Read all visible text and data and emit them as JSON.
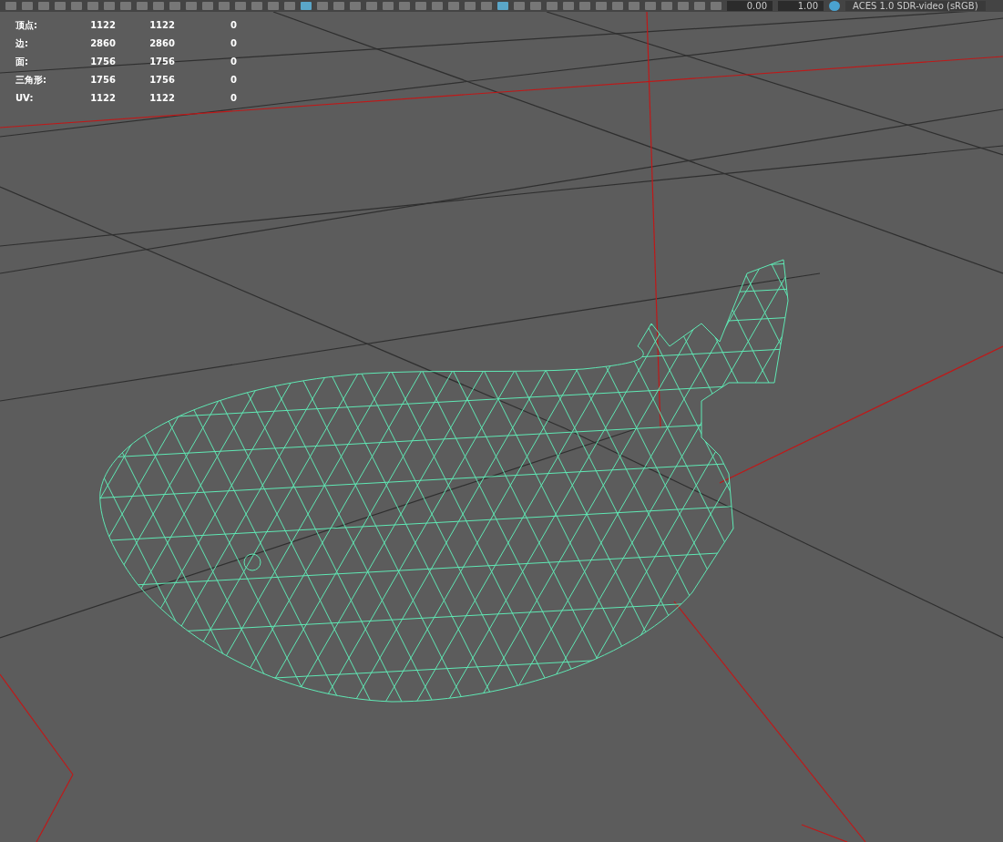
{
  "toolbar": {
    "fields": [
      {
        "value": "0.00"
      },
      {
        "value": "1.00"
      }
    ],
    "color_space": "ACES 1.0 SDR-video (sRGB)"
  },
  "stats": [
    {
      "label": "顶点:",
      "values": [
        "1122",
        "1122",
        "0"
      ]
    },
    {
      "label": "边:",
      "values": [
        "2860",
        "2860",
        "0"
      ]
    },
    {
      "label": "面:",
      "values": [
        "1756",
        "1756",
        "0"
      ]
    },
    {
      "label": "三角形:",
      "values": [
        "1756",
        "1756",
        "0"
      ]
    },
    {
      "label": "UV:",
      "values": [
        "1122",
        "1122",
        "0"
      ]
    }
  ]
}
